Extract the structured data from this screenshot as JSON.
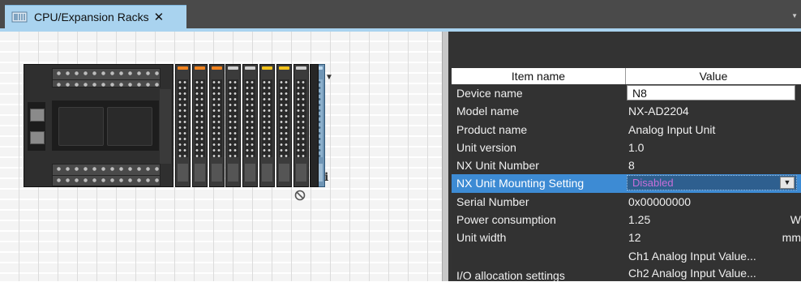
{
  "tab": {
    "title": "CPU/Expansion Racks",
    "close": "✕",
    "overflow": "▼"
  },
  "rack": {
    "scroll_button": "▼",
    "info_label": "i",
    "module_leds": [
      "#f0821e",
      "#f0821e",
      "#f0821e",
      "#cfcfcf",
      "#cfcfcf",
      "#f2c21b",
      "#f2c21b",
      "#cfcfcf"
    ],
    "selected_module_led": "#bcd8ee"
  },
  "properties": {
    "header": {
      "item_name": "Item name",
      "value": "Value"
    },
    "rows": [
      {
        "name": "Device name",
        "value": "N8"
      },
      {
        "name": "Model name",
        "value": "NX-AD2204"
      },
      {
        "name": "Product name",
        "value": "Analog Input Unit"
      },
      {
        "name": "Unit version",
        "value": "1.0"
      },
      {
        "name": "NX Unit Number",
        "value": "8"
      },
      {
        "name": "NX Unit Mounting Setting",
        "value": "Disabled"
      },
      {
        "name": "Serial Number",
        "value": "0x00000000"
      },
      {
        "name": "Power consumption",
        "value": "1.25",
        "unit": "W"
      },
      {
        "name": "Unit width",
        "value": "12",
        "unit": "mm"
      }
    ],
    "io_row": {
      "name": "I/O allocation settings",
      "value1": "Ch1 Analog Input Value...",
      "value2": "Ch2 Analog Input Value..."
    }
  }
}
